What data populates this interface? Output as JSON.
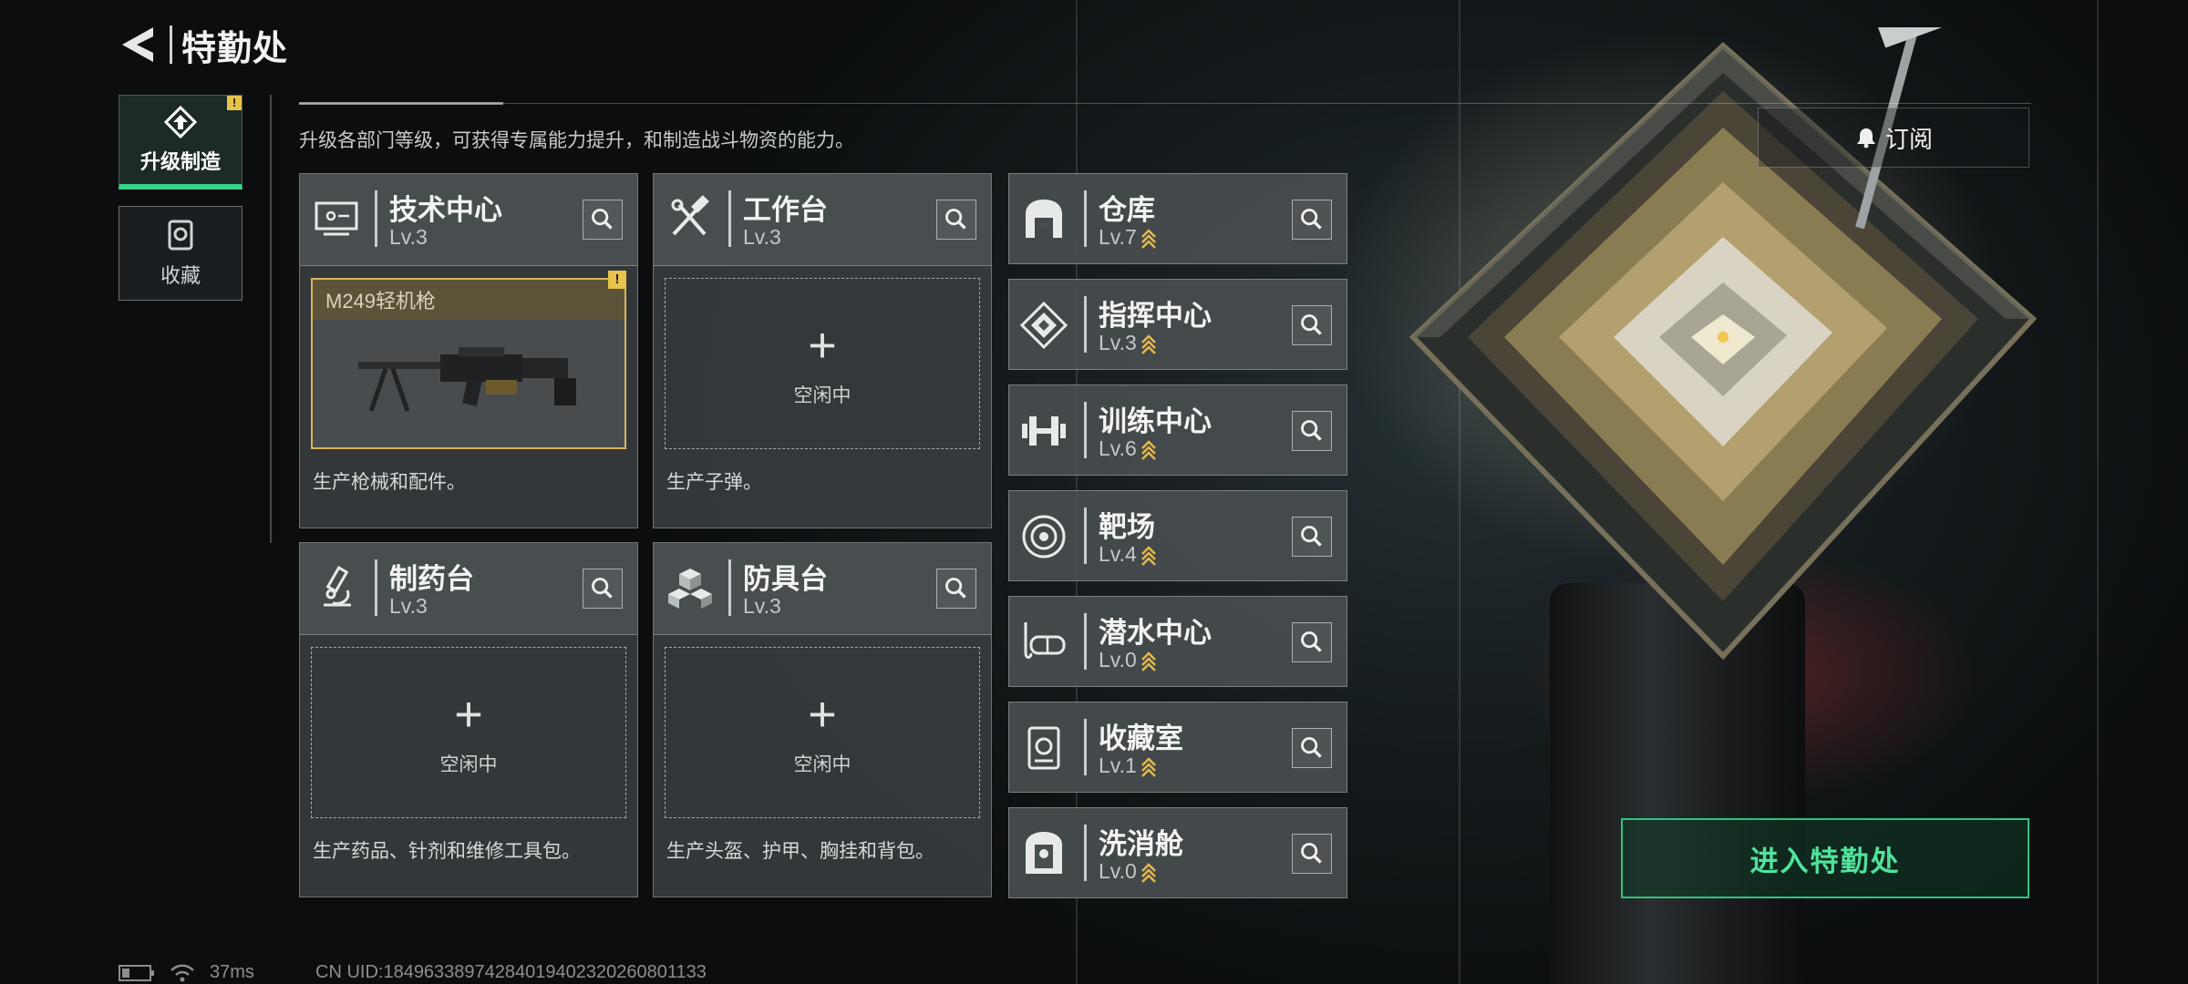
{
  "header": {
    "title": "特勤处"
  },
  "tabs": [
    {
      "label": "升级制造",
      "active": true,
      "alert": "!"
    },
    {
      "label": "收藏",
      "active": false
    }
  ],
  "description": "升级各部门等级，可获得专属能力提升，和制造战斗物资的能力。",
  "subscribe_label": "订阅",
  "panels": [
    {
      "name": "技术中心",
      "level": "Lv.3",
      "icon": "monitor-icon",
      "slot_state": "busy",
      "slot_item": "M249轻机枪",
      "slot_alert": "!",
      "desc": "生产枪械和配件。"
    },
    {
      "name": "工作台",
      "level": "Lv.3",
      "icon": "tools-icon",
      "slot_state": "idle",
      "idle_label": "空闲中",
      "desc": "生产子弹。"
    },
    {
      "name": "制药台",
      "level": "Lv.3",
      "icon": "microscope-icon",
      "slot_state": "idle",
      "idle_label": "空闲中",
      "desc": "生产药品、针剂和维修工具包。"
    },
    {
      "name": "防具台",
      "level": "Lv.3",
      "icon": "blocks-icon",
      "slot_state": "idle",
      "idle_label": "空闲中",
      "desc": "生产头盔、护甲、胸挂和背包。"
    }
  ],
  "facilities": [
    {
      "name": "仓库",
      "level": "Lv.7",
      "icon": "warehouse-icon",
      "upgradable": true
    },
    {
      "name": "指挥中心",
      "level": "Lv.3",
      "icon": "command-icon",
      "upgradable": true
    },
    {
      "name": "训练中心",
      "level": "Lv.6",
      "icon": "dumbbell-icon",
      "upgradable": true
    },
    {
      "name": "靶场",
      "level": "Lv.4",
      "icon": "target-icon",
      "upgradable": true
    },
    {
      "name": "潜水中心",
      "level": "Lv.0",
      "icon": "diving-mask-icon",
      "upgradable": true
    },
    {
      "name": "收藏室",
      "level": "Lv.1",
      "icon": "collection-icon",
      "upgradable": true
    },
    {
      "name": "洗消舱",
      "level": "Lv.0",
      "icon": "decon-icon",
      "upgradable": true
    }
  ],
  "enter_label": "进入特勤处",
  "status": {
    "ping": "37ms",
    "uid": "CN UID:18496338974284019402320260801133"
  },
  "colors": {
    "accent": "#36d48a",
    "gold": "#d9b45a",
    "alert": "#e8c24a"
  }
}
